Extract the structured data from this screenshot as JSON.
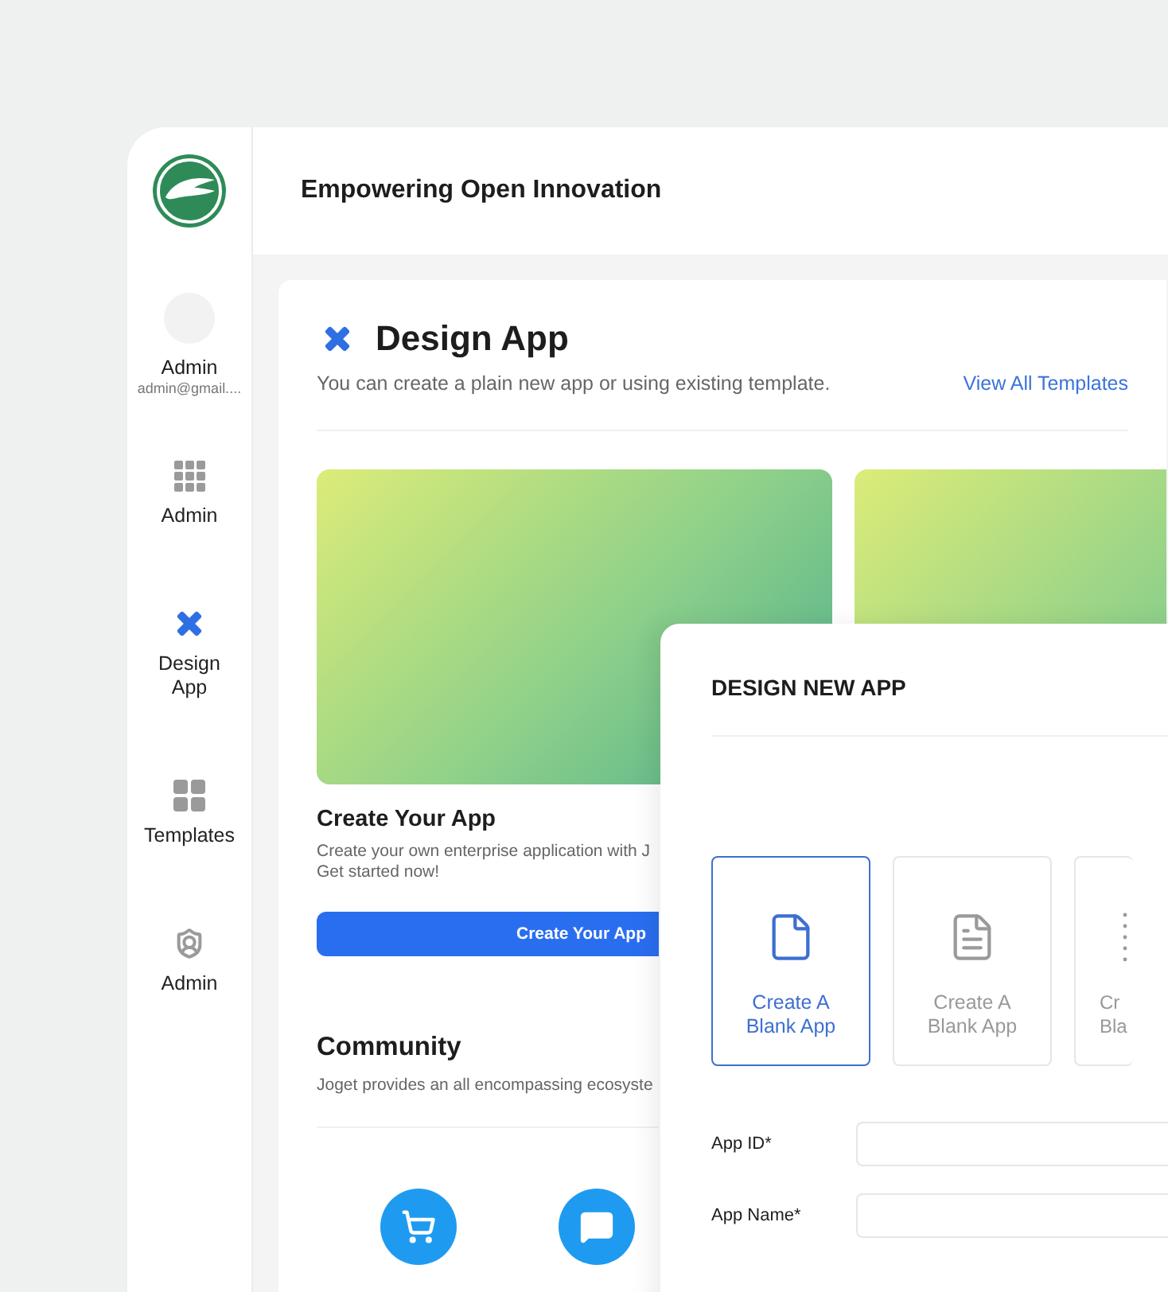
{
  "sidebar": {
    "profile": {
      "name": "Admin",
      "email": "admin@gmail...."
    },
    "items": [
      {
        "kind": "grid",
        "label": "Admin",
        "selected": false
      },
      {
        "kind": "design",
        "label": "Design App",
        "selected": true
      },
      {
        "kind": "tiles",
        "label": "Templates",
        "selected": false
      },
      {
        "kind": "shield",
        "label": "Admin",
        "selected": false
      }
    ]
  },
  "header": {
    "title": "Empowering Open Innovation"
  },
  "page": {
    "title": "Design App",
    "subtitle": "You can create a plain new app or using existing template.",
    "link": "View All Templates",
    "create": {
      "title": "Create Your App",
      "description": [
        "Create your own enterprise application with J",
        "Get started now!"
      ],
      "button": "Create Your App"
    },
    "community": {
      "title": "Community",
      "description": "Joget provides an all encompassing ecosyste",
      "icons": [
        {
          "kind": "cart"
        },
        {
          "kind": "chat"
        }
      ]
    }
  },
  "dialog": {
    "title": "DESIGN NEW APP",
    "options": [
      {
        "kind": "file",
        "label": "Create A Blank App",
        "selected": true
      },
      {
        "kind": "document",
        "label": "Create A Blank App",
        "selected": false
      },
      {
        "kind": "dots",
        "label": [
          "Cr",
          "Bla"
        ],
        "selected": false
      }
    ],
    "fields": [
      {
        "label": "App ID*"
      },
      {
        "label": "App Name*"
      }
    ]
  }
}
